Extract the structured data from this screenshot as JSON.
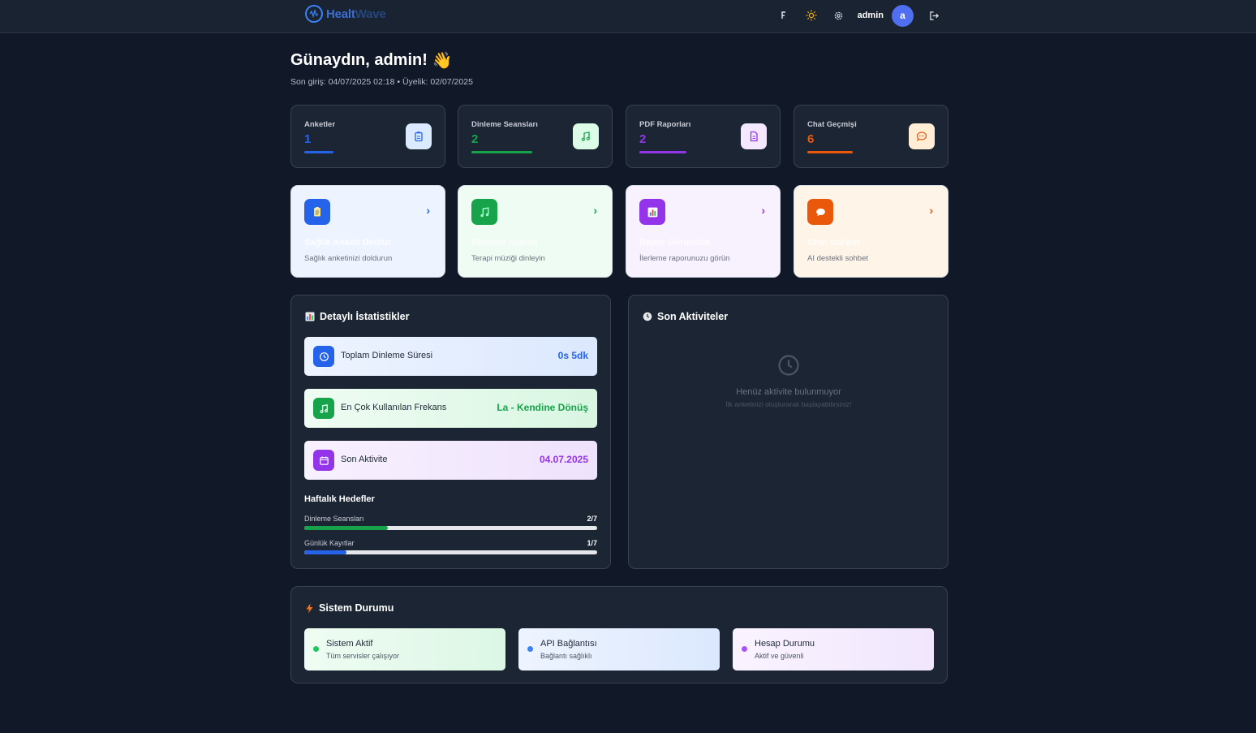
{
  "header": {
    "logo_prefix": "Healt",
    "logo_suffix": "Wave",
    "username": "admin",
    "avatar_letter": "a"
  },
  "greeting": {
    "title": "Günaydın, admin!",
    "emoji": "👋",
    "meta": "Son giriş: 04/07/2025 02:18 • Üyelik: 02/07/2025"
  },
  "stats": [
    {
      "label": "Anketler",
      "value": "1",
      "color": "#2563eb"
    },
    {
      "label": "Dinleme Seansları",
      "value": "2",
      "color": "#16a34a"
    },
    {
      "label": "PDF Raporları",
      "value": "2",
      "color": "#9333ea"
    },
    {
      "label": "Chat Geçmişi",
      "value": "6",
      "color": "#ea580c"
    }
  ],
  "actions": [
    {
      "title": "Sağlık Anketi Doldur",
      "desc": "Sağlık anketinizi doldurun"
    },
    {
      "title": "Dinleme Seansı",
      "desc": "Terapi müziği dinleyin"
    },
    {
      "title": "Rapor Görüntüle",
      "desc": "İlerleme raporunuzu görün"
    },
    {
      "title": "Chat Sohbet",
      "desc": "AI destekli sohbet"
    }
  ],
  "details": {
    "title": "Detaylı İstatistikler",
    "metrics": [
      {
        "label": "Toplam Dinleme Süresi",
        "value": "0s 5dk"
      },
      {
        "label": "En Çok Kullanılan Frekans",
        "value": "La - Kendine Dönüş"
      },
      {
        "label": "Son Aktivite",
        "value": "04.07.2025"
      }
    ],
    "goals_title": "Haftalık Hedefler",
    "goals": [
      {
        "label": "Dinleme Seansları",
        "value": "2/7",
        "progress": 0.2857
      },
      {
        "label": "Günlük Kayıtlar",
        "value": "1/7",
        "progress": 0.1429
      }
    ]
  },
  "activities": {
    "title": "Son Aktiviteler",
    "empty_title": "Henüz aktivite bulunmuyor",
    "empty_desc": "İlk anketinizi oluşturarak başlayabilirsiniz!"
  },
  "system": {
    "title": "Sistem Durumu",
    "items": [
      {
        "title": "Sistem Aktif",
        "desc": "Tüm servisler çalışıyor"
      },
      {
        "title": "API Bağlantısı",
        "desc": "Bağlantı sağlıklı"
      },
      {
        "title": "Hesap Durumu",
        "desc": "Aktif ve güvenli"
      }
    ]
  }
}
